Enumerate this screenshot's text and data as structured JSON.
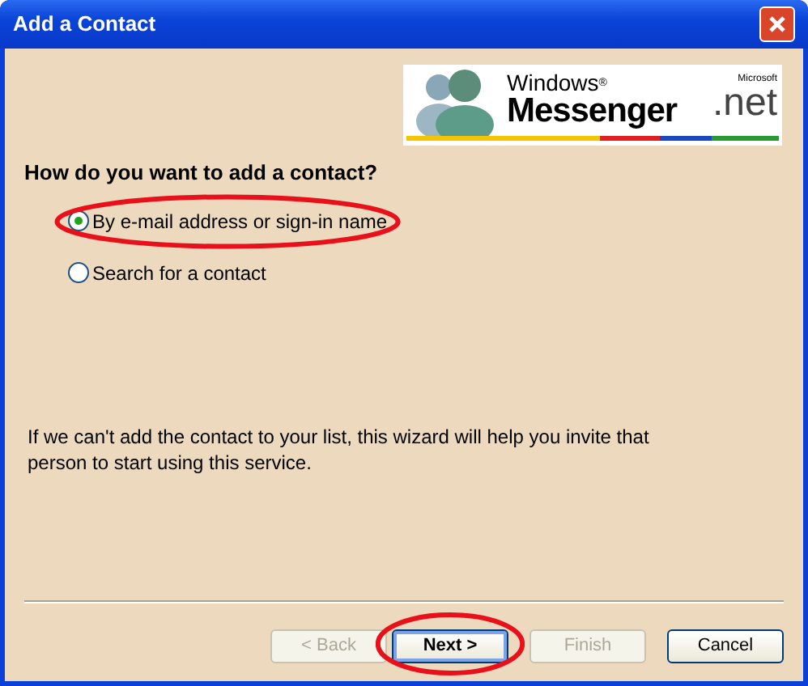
{
  "window": {
    "title": "Add a Contact"
  },
  "logo": {
    "line_1": "Windows",
    "mark": "®",
    "line_2": "Messenger",
    "vendor": "Microsoft",
    "suffix": ".net"
  },
  "question": "How do you want to add a contact?",
  "options": [
    {
      "label": "By e-mail address or sign-in name",
      "selected": true,
      "highlighted": true
    },
    {
      "label": "Search for a contact",
      "selected": false,
      "highlighted": false
    }
  ],
  "note": "If we can't add the contact to your list, this wizard will help you invite that person to start using this service.",
  "buttons": [
    {
      "label": "< Back",
      "disabled": true,
      "default": false,
      "highlighted": false
    },
    {
      "label": "Next >",
      "disabled": false,
      "default": true,
      "highlighted": true
    },
    {
      "label": "Finish",
      "disabled": true,
      "default": false,
      "highlighted": false
    },
    {
      "label": "Cancel",
      "disabled": false,
      "default": false,
      "highlighted": false
    }
  ]
}
